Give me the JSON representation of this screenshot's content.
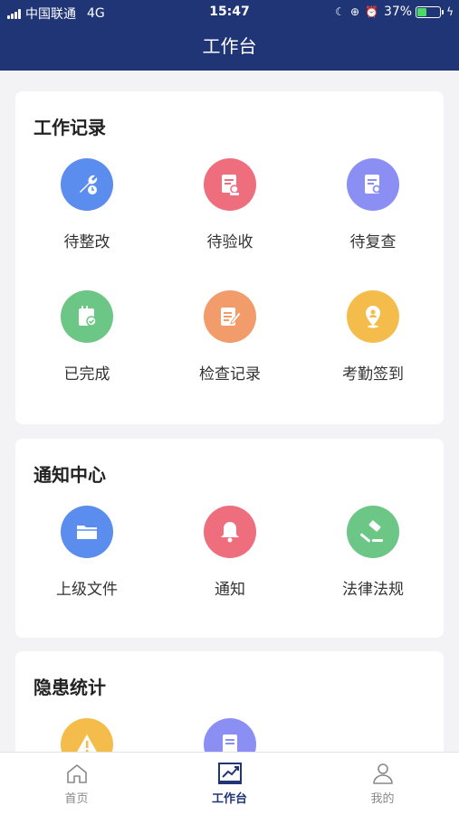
{
  "status_bar": {
    "carrier": "中国联通",
    "network": "4G",
    "time": "15:47",
    "battery": "37%",
    "battery_level": 0.37
  },
  "header": {
    "title": "工作台"
  },
  "sections": [
    {
      "title": "工作记录",
      "items": [
        {
          "label": "待整改",
          "icon": "wrench-clock-icon",
          "color": "#5b8def"
        },
        {
          "label": "待验收",
          "icon": "document-stamp-icon",
          "color": "#ee6e7e"
        },
        {
          "label": "待复查",
          "icon": "document-search-icon",
          "color": "#8b8ef3"
        },
        {
          "label": "已完成",
          "icon": "clipboard-check-icon",
          "color": "#6cc685"
        },
        {
          "label": "检查记录",
          "icon": "document-edit-icon",
          "color": "#f29b6b"
        },
        {
          "label": "考勤签到",
          "icon": "location-pin-icon",
          "color": "#f4bd4b"
        }
      ]
    },
    {
      "title": "通知中心",
      "items": [
        {
          "label": "上级文件",
          "icon": "folder-icon",
          "color": "#5b8def"
        },
        {
          "label": "通知",
          "icon": "bell-icon",
          "color": "#ee6e7e"
        },
        {
          "label": "法律法规",
          "icon": "gavel-icon",
          "color": "#6cc685"
        }
      ]
    },
    {
      "title": "隐患统计",
      "items": [
        {
          "icon": "warning-icon",
          "color": "#f4bd4b"
        },
        {
          "icon": "document-stats-icon",
          "color": "#8b8ef3"
        }
      ]
    }
  ],
  "tabbar": {
    "tabs": [
      {
        "label": "首页",
        "icon": "home-icon"
      },
      {
        "label": "工作台",
        "icon": "chart-icon",
        "active": true
      },
      {
        "label": "我的",
        "icon": "user-icon"
      }
    ],
    "active_color": "#1f3575",
    "inactive_color": "#888888"
  },
  "theme": {
    "primary": "#1f3575",
    "background": "#f3f3f5"
  }
}
